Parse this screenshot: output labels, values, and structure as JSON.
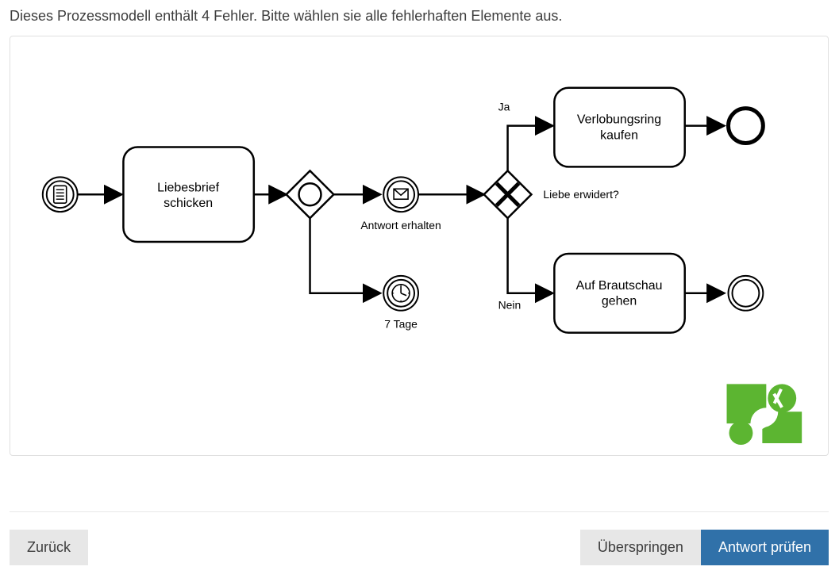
{
  "instruction": "Dieses Prozessmodell enthält 4 Fehler. Bitte wählen sie alle fehlerhaften Elemente aus.",
  "diagram": {
    "tasks": {
      "t1_line1": "Liebesbrief",
      "t1_line2": "schicken",
      "t2_line1": "Verlobungsring",
      "t2_line2": "kaufen",
      "t3_line1": "Auf Brautschau",
      "t3_line2": "gehen"
    },
    "events": {
      "message_label": "Antwort erhalten",
      "timer_label": "7 Tage"
    },
    "gateway": {
      "question": "Liebe erwidert?",
      "yes": "Ja",
      "no": "Nein"
    }
  },
  "buttons": {
    "back": "Zurück",
    "skip": "Überspringen",
    "check": "Antwort prüfen"
  }
}
